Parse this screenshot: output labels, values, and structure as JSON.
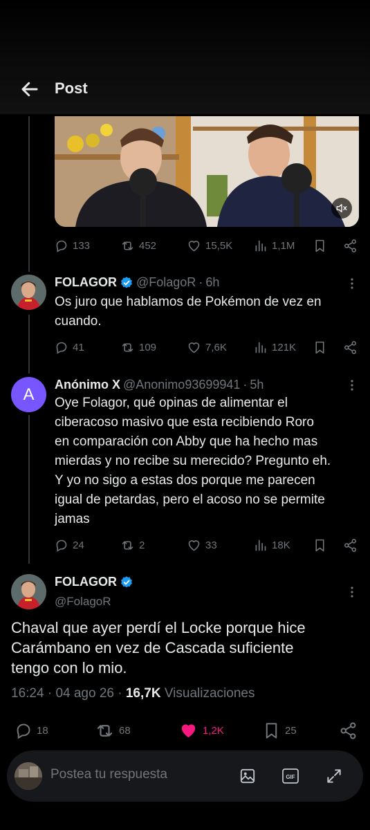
{
  "header": {
    "title": "Post"
  },
  "parent_post": {
    "stats": {
      "replies": "133",
      "reposts": "452",
      "likes": "15,5K",
      "views": "1,1M"
    }
  },
  "reply1": {
    "name": "FOLAGOR",
    "handle": "@FolagoR",
    "time": "6h",
    "lines": [
      "Os juro que hablamos de Pokémon de vez en",
      "cuando."
    ],
    "stats": {
      "replies": "41",
      "reposts": "109",
      "likes": "7,6K",
      "views": "121K"
    }
  },
  "reply2": {
    "avatar_letter": "A",
    "name": "Anónimo X",
    "handle": "@Anonimo93699941",
    "time": "5h",
    "lines": [
      "Oye Folagor, qué opinas de alimentar el",
      "ciberacoso masivo que esta recibiendo Roro",
      "en comparación con Abby que ha hecho mas",
      "mierdas y no recibe su merecido? Pregunto eh.",
      "Y yo no sigo a estas dos porque me parecen",
      "igual de petardas, pero el acoso no se permite",
      "jamas"
    ],
    "stats": {
      "replies": "24",
      "reposts": "2",
      "likes": "33",
      "views": "18K"
    }
  },
  "main_post": {
    "name": "FOLAGOR",
    "handle": "@FolagoR",
    "lines": [
      "Chaval que ayer perdí el Locke porque hice",
      "Carámbano en vez de Cascada suficiente",
      "tengo con lo mio."
    ],
    "time": "16:24",
    "date": "04 ago 26",
    "views": "16,7K",
    "views_label": "Visualizaciones",
    "stats": {
      "replies": "18",
      "reposts": "68",
      "likes": "1,2K",
      "bookmarks": "25"
    }
  },
  "reply_bar": {
    "placeholder": "Postea tu respuesta",
    "gif_label": "GIF"
  },
  "colors": {
    "accent": "#1d9bf0",
    "like_active": "#f91880",
    "muted": "#71767b"
  }
}
